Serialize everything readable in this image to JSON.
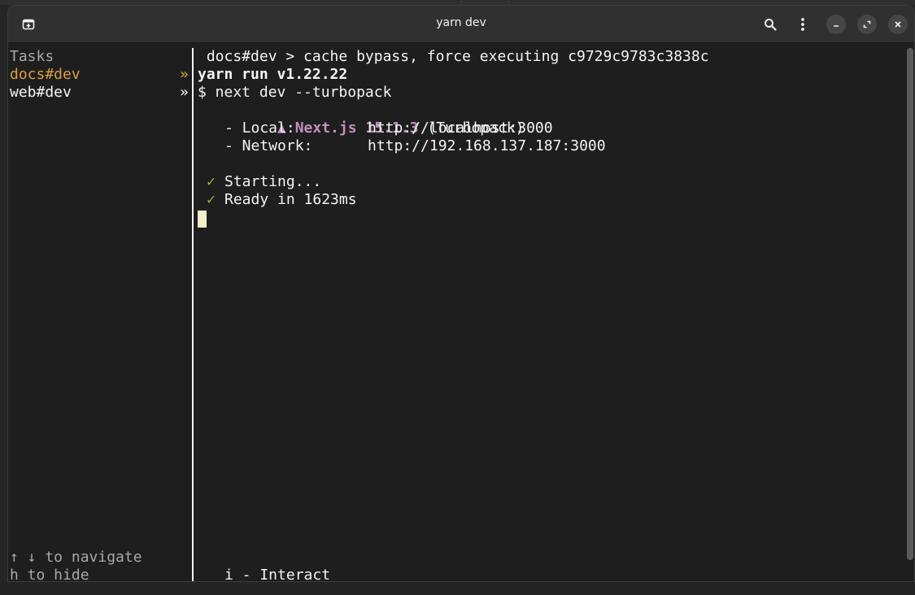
{
  "window": {
    "title": "yarn dev"
  },
  "sidebar": {
    "heading": "Tasks",
    "tasks": [
      {
        "label": "docs#dev",
        "marker": "»",
        "active": true
      },
      {
        "label": "web#dev",
        "marker": "»",
        "active": false
      }
    ],
    "help": [
      "↑ ↓ to navigate",
      "h to hide"
    ]
  },
  "output": {
    "line1": " docs#dev > cache bypass, force executing c9729c9783c3838c",
    "line2": "yarn run v1.22.22",
    "line3": "$ next dev --turbopack",
    "next_icon": "▲",
    "next_version": "Next.js 15.1.3",
    "turbopack": "(Turbopack)",
    "local_label": "- Local:",
    "local_url": "http://localhost:3000",
    "network_label": "- Network:",
    "network_url": "http://192.168.137.187:3000",
    "check": "✓",
    "starting": "Starting...",
    "ready": "Ready in 1623ms",
    "footer": "i - Interact"
  },
  "icons": {
    "new_tab": "new-tab-icon",
    "search": "search-icon",
    "menu": "kebab-menu-icon",
    "minimize": "minimize-icon",
    "restore": "restore-icon",
    "close": "close-icon"
  },
  "colors": {
    "active_task": "#d9a13a",
    "next_purple": "#c38dc0",
    "check_green": "#a6b033",
    "cursor": "#f3edc8"
  }
}
